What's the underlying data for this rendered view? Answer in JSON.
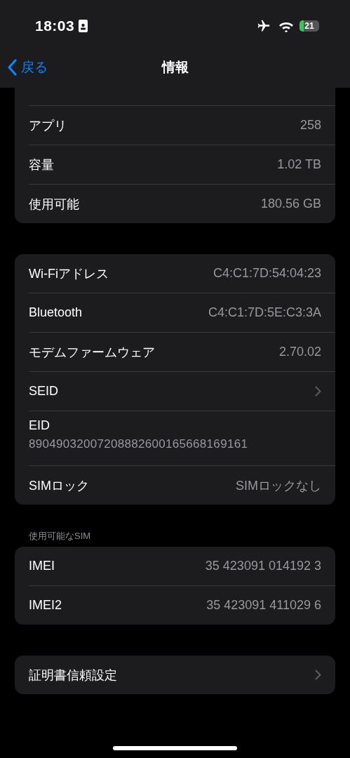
{
  "status_bar": {
    "time": "18:03",
    "battery": "21"
  },
  "nav": {
    "back": "戻る",
    "title": "情報"
  },
  "groups": [
    {
      "continued": true,
      "rows": [
        {
          "kind": "value",
          "label": "アプリ",
          "value": "258"
        },
        {
          "kind": "value",
          "label": "容量",
          "value": "1.02 TB"
        },
        {
          "kind": "value",
          "label": "使用可能",
          "value": "180.56 GB"
        }
      ]
    },
    {
      "rows": [
        {
          "kind": "value",
          "label": "Wi-Fiアドレス",
          "value": "C4:C1:7D:54:04:23"
        },
        {
          "kind": "value",
          "label": "Bluetooth",
          "value": "C4:C1:7D:5E:C3:3A"
        },
        {
          "kind": "value",
          "label": "モデムファームウェア",
          "value": "2.70.02"
        },
        {
          "kind": "link",
          "label": "SEID"
        },
        {
          "kind": "stacked",
          "label": "EID",
          "value": "89049032007208882600165668169161"
        },
        {
          "kind": "value",
          "label": "SIMロック",
          "value": "SIMロックなし"
        }
      ]
    },
    {
      "header": "使用可能なSIM",
      "rows": [
        {
          "kind": "value",
          "label": "IMEI",
          "value": "35 423091 014192 3"
        },
        {
          "kind": "value",
          "label": "IMEI2",
          "value": "35 423091 411029 6"
        }
      ]
    },
    {
      "rows": [
        {
          "kind": "link",
          "label": "証明書信頼設定"
        }
      ]
    }
  ]
}
